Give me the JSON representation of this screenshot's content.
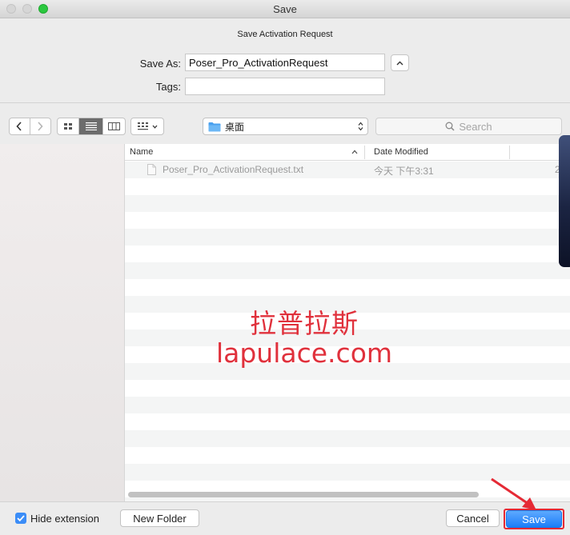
{
  "window": {
    "title": "Save"
  },
  "sheet": {
    "title": "Save Activation Request"
  },
  "form": {
    "save_as_label": "Save As:",
    "save_as_value": "Poser_Pro_ActivationRequest",
    "tags_label": "Tags:",
    "tags_value": ""
  },
  "toolbar": {
    "location": "桌面",
    "search_placeholder": "Search"
  },
  "filelist": {
    "columns": [
      "Name",
      "Date Modified"
    ],
    "files": [
      {
        "name": "Poser_Pro_ActivationRequest.txt",
        "date_modified": "今天 下午3:31",
        "truncated": "2"
      }
    ]
  },
  "watermark": {
    "line1": "拉普拉斯",
    "line2": "lapulace.com",
    "color": "#e0313c"
  },
  "bottom": {
    "hide_extension_label": "Hide extension",
    "hide_extension_checked": true,
    "new_folder_label": "New Folder",
    "cancel_label": "Cancel",
    "save_label": "Save"
  },
  "colors": {
    "accent": "#1b7ef8",
    "highlight": "#e52a35"
  }
}
